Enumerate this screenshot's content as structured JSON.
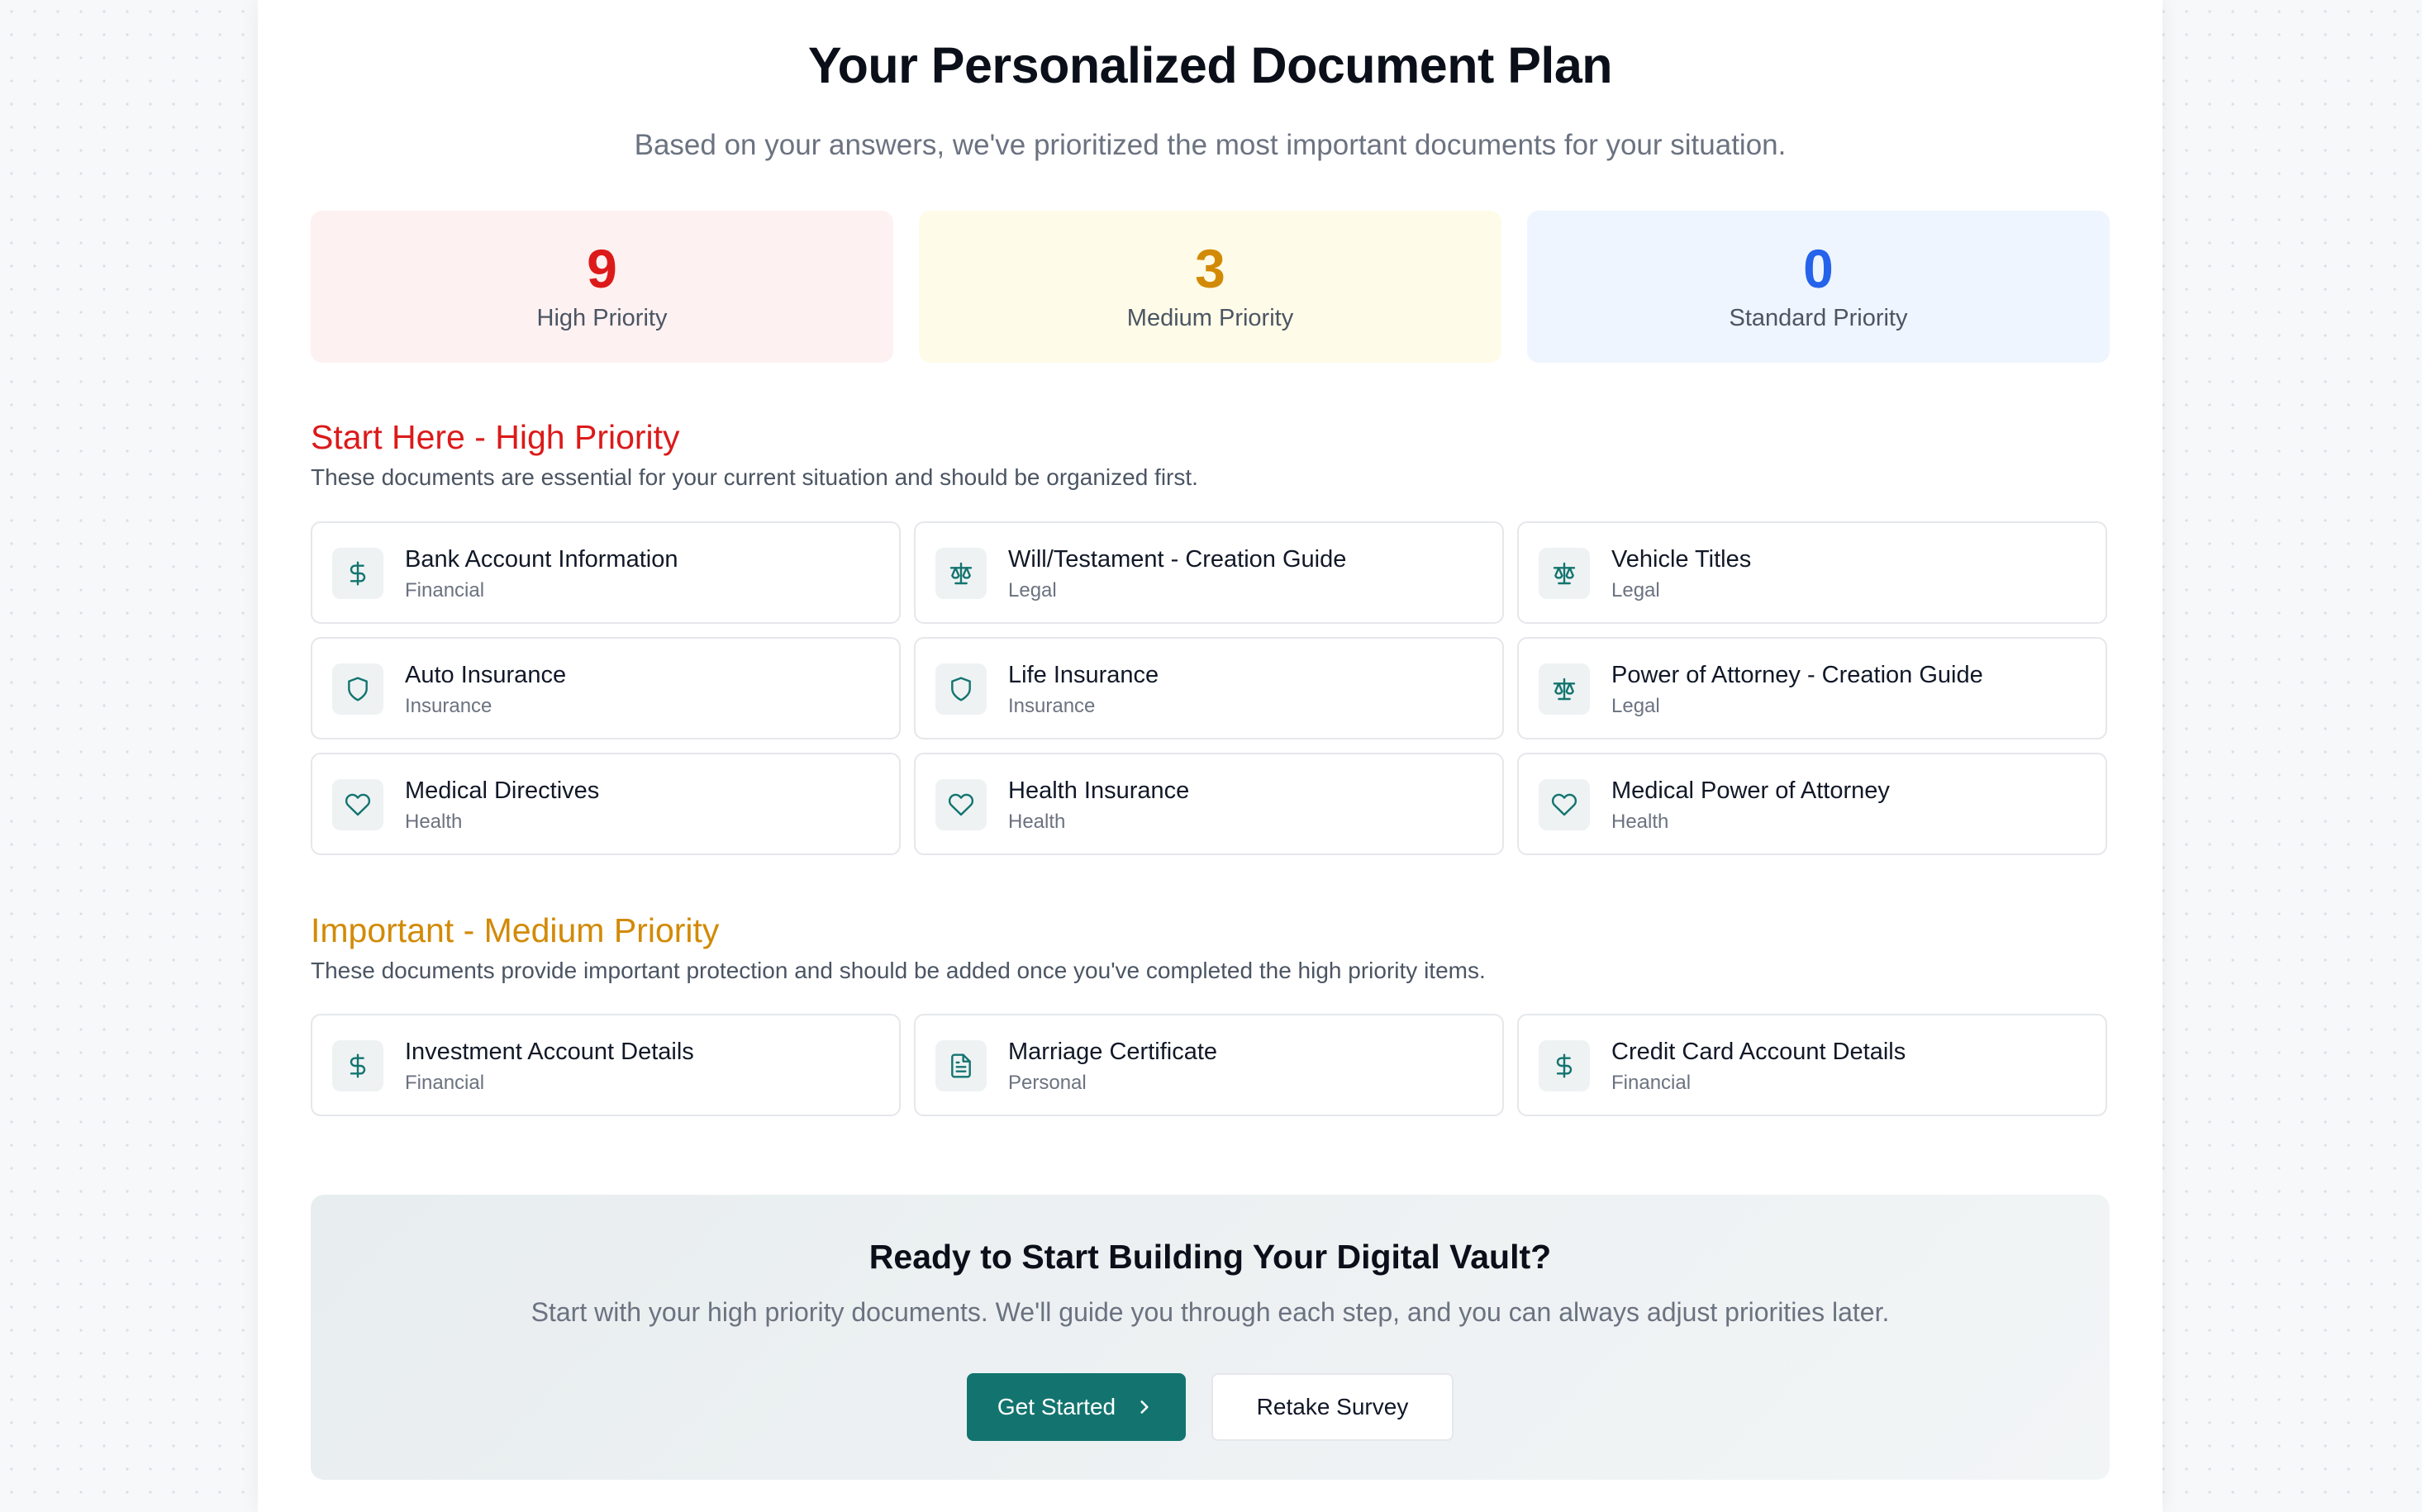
{
  "header": {
    "title": "Your Personalized Document Plan",
    "subtitle": "Based on your answers, we've prioritized the most important documents for your situation."
  },
  "stats": {
    "high": {
      "count": "9",
      "label": "High Priority"
    },
    "medium": {
      "count": "3",
      "label": "Medium Priority"
    },
    "standard": {
      "count": "0",
      "label": "Standard Priority"
    }
  },
  "high_section": {
    "title": "Start Here - High Priority",
    "description": "These documents are essential for your current situation and should be organized first.",
    "items": [
      {
        "name": "Bank Account Information",
        "category": "Financial",
        "icon": "dollar-icon"
      },
      {
        "name": "Will/Testament - Creation Guide",
        "category": "Legal",
        "icon": "scale-icon"
      },
      {
        "name": "Vehicle Titles",
        "category": "Legal",
        "icon": "scale-icon"
      },
      {
        "name": "Auto Insurance",
        "category": "Insurance",
        "icon": "shield-icon"
      },
      {
        "name": "Life Insurance",
        "category": "Insurance",
        "icon": "shield-icon"
      },
      {
        "name": "Power of Attorney - Creation Guide",
        "category": "Legal",
        "icon": "scale-icon"
      },
      {
        "name": "Medical Directives",
        "category": "Health",
        "icon": "heart-icon"
      },
      {
        "name": "Health Insurance",
        "category": "Health",
        "icon": "heart-icon"
      },
      {
        "name": "Medical Power of Attorney",
        "category": "Health",
        "icon": "heart-icon"
      }
    ]
  },
  "medium_section": {
    "title": "Important - Medium Priority",
    "description": "These documents provide important protection and should be added once you've completed the high priority items.",
    "items": [
      {
        "name": "Investment Account Details",
        "category": "Financial",
        "icon": "dollar-icon"
      },
      {
        "name": "Marriage Certificate",
        "category": "Personal",
        "icon": "document-icon"
      },
      {
        "name": "Credit Card Account Details",
        "category": "Financial",
        "icon": "dollar-icon"
      }
    ]
  },
  "cta": {
    "title": "Ready to Start Building Your Digital Vault?",
    "description": "Start with your high priority documents. We'll guide you through each step, and you can always adjust priorities later.",
    "primary_label": "Get Started",
    "secondary_label": "Retake Survey"
  },
  "colors": {
    "high": "#dc1a1a",
    "medium": "#d28a06",
    "standard": "#2563eb",
    "accent": "#13746f"
  }
}
